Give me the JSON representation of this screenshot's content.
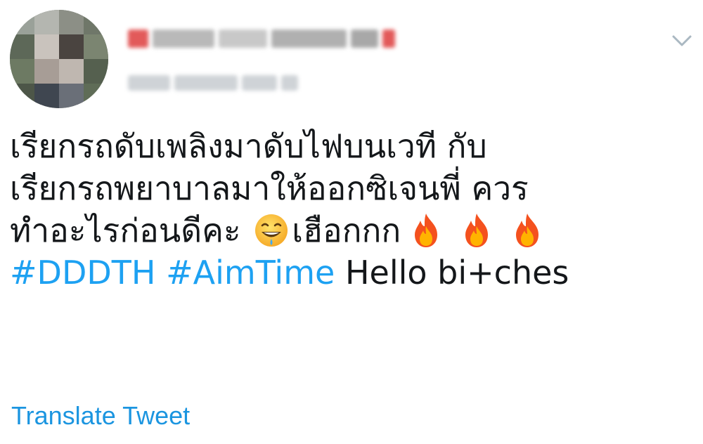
{
  "tweet": {
    "line1": "เรียกรถดับเพลิงมาดับไฟบนเวที กับ",
    "line2": "เรียกรถพยาบาลมาให้ออกซิเจนพี่ ควร",
    "line3_text": "ทำอะไรก่อนดีคะ ",
    "line3_after_emoji": "เฮือกกก",
    "hashtag1": "#DDDTH",
    "hashtag2": "#AimTime",
    "line4_text": "Hello bi+ches",
    "emoji_face": "grinning-face-with-sweat-icon",
    "emoji_fire": "fire-icon"
  },
  "actions": {
    "translate_label": "Translate Tweet"
  },
  "colors": {
    "link": "#1da1f2",
    "translate": "#1b95e0",
    "text": "#14171a"
  }
}
